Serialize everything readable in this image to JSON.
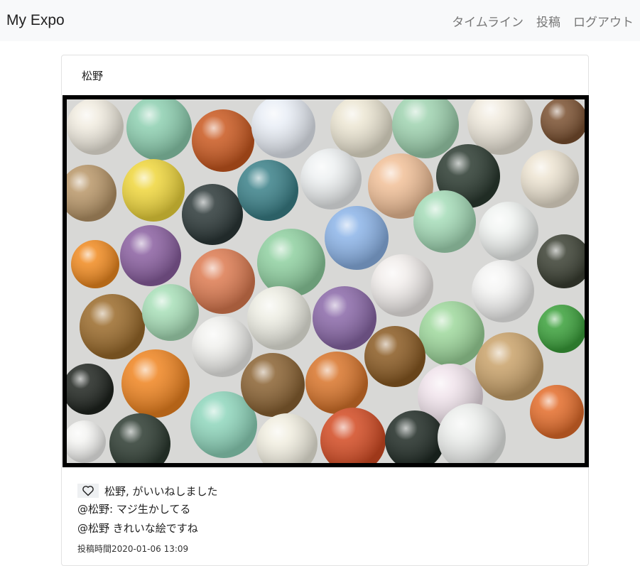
{
  "navbar": {
    "brand": "My Expo",
    "links": [
      "タイムライン",
      "投稿",
      "ログアウト"
    ]
  },
  "post": {
    "author": "松野",
    "image_icon": "marbles-photo",
    "likes_text": "松野, がいいねしました",
    "comments": [
      {
        "text": "@松野: マジ生かしてる"
      },
      {
        "text": "@松野  きれいな絵ですね"
      }
    ],
    "posted_label": "投稿時間",
    "posted_time": "2020-01-06 13:09"
  },
  "colors": {
    "navbar_bg": "#f8f9fa",
    "image_border": "#000000"
  }
}
